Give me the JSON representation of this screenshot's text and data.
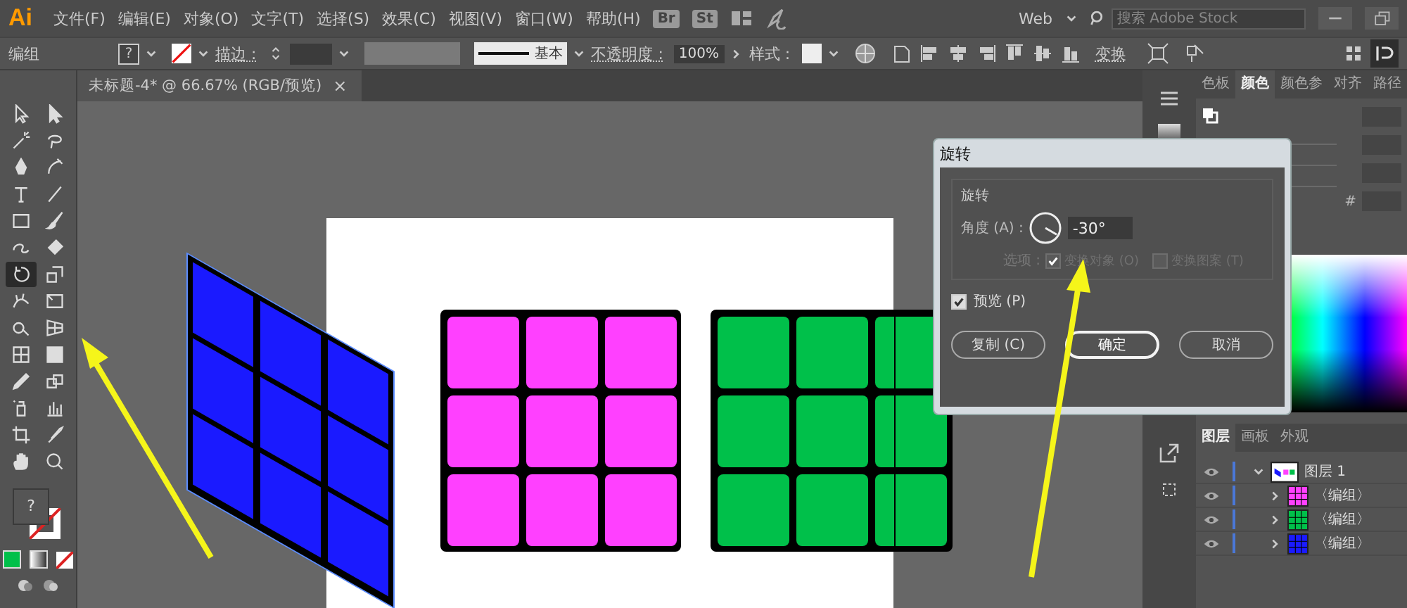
{
  "app": {
    "logo": "Ai"
  },
  "menu": [
    "文件(F)",
    "编辑(E)",
    "对象(O)",
    "文字(T)",
    "选择(S)",
    "效果(C)",
    "视图(V)",
    "窗口(W)",
    "帮助(H)"
  ],
  "menubar_right": {
    "bridge": "Br",
    "stock": "St",
    "workspace": "Web",
    "search_placeholder": "搜索 Adobe Stock"
  },
  "control_bar": {
    "selection": "编组",
    "fill": "?",
    "stroke_label": "描边 :",
    "stroke_profile": "基本",
    "opacity_label": "不透明度 :",
    "opacity": "100%",
    "style_label": "样式 :",
    "transform": "变换"
  },
  "document_tab": {
    "title": "未标题-4* @ 66.67% (RGB/预览)",
    "close": "×"
  },
  "tools": [
    {
      "kind": "selection",
      "selected": false
    },
    {
      "kind": "direct",
      "selected": false
    },
    {
      "kind": "wand",
      "selected": false
    },
    {
      "kind": "lasso",
      "selected": false
    },
    {
      "kind": "pen",
      "selected": false
    },
    {
      "kind": "curvature",
      "selected": false
    },
    {
      "kind": "type",
      "selected": false
    },
    {
      "kind": "line",
      "selected": false
    },
    {
      "kind": "rectangle",
      "selected": false
    },
    {
      "kind": "brush",
      "selected": false
    },
    {
      "kind": "shaper",
      "selected": false
    },
    {
      "kind": "eraser",
      "selected": false
    },
    {
      "kind": "rotate",
      "selected": true
    },
    {
      "kind": "scale",
      "selected": false
    },
    {
      "kind": "width",
      "selected": false
    },
    {
      "kind": "free",
      "selected": false
    },
    {
      "kind": "builder",
      "selected": false
    },
    {
      "kind": "perspective",
      "selected": false
    },
    {
      "kind": "mesh",
      "selected": false
    },
    {
      "kind": "gradient",
      "selected": false
    },
    {
      "kind": "eyedropper",
      "selected": false
    },
    {
      "kind": "blend",
      "selected": false
    },
    {
      "kind": "sprayer",
      "selected": false
    },
    {
      "kind": "graph",
      "selected": false
    },
    {
      "kind": "artboard",
      "selected": false
    },
    {
      "kind": "slice",
      "selected": false
    },
    {
      "kind": "hand",
      "selected": false
    },
    {
      "kind": "zoom",
      "selected": false
    }
  ],
  "toolbar_swatches": {
    "fill": "?"
  },
  "dialog": {
    "title": "旋转",
    "group_title": "旋转",
    "angle_label": "角度 (A) :",
    "angle": "-30°",
    "options_label": "选项 :",
    "options": [
      {
        "label": "变换对象 (O)",
        "checked": true,
        "disabled": true
      },
      {
        "label": "变换图案 (T)",
        "checked": false,
        "disabled": true
      }
    ],
    "preview": {
      "label": "预览 (P)",
      "checked": true
    },
    "buttons": [
      {
        "label": "复制 (C)",
        "default": false
      },
      {
        "label": "确定",
        "default": true
      },
      {
        "label": "取消",
        "default": false
      }
    ]
  },
  "color_panel": {
    "tabs": [
      {
        "label": "色板",
        "selected": false
      },
      {
        "label": "颜色",
        "selected": true
      },
      {
        "label": "颜色参",
        "selected": false
      },
      {
        "label": "对齐",
        "selected": false
      },
      {
        "label": "路径",
        "selected": false
      }
    ],
    "hex_label": "#"
  },
  "layers_panel": {
    "tabs": [
      {
        "label": "图层",
        "selected": true
      },
      {
        "label": "画板",
        "selected": false
      },
      {
        "label": "外观",
        "selected": false
      }
    ],
    "layers": [
      {
        "name": "图层 1",
        "visible": true,
        "expanded": true,
        "children": [
          {
            "name": "〈编组〉",
            "visible": true,
            "expanded": false,
            "color": "#ff40ff"
          },
          {
            "name": "〈编组〉",
            "visible": true,
            "expanded": false,
            "color": "#00c04a"
          },
          {
            "name": "〈编组〉",
            "visible": true,
            "expanded": false,
            "color": "#1a1aff"
          }
        ]
      }
    ]
  }
}
